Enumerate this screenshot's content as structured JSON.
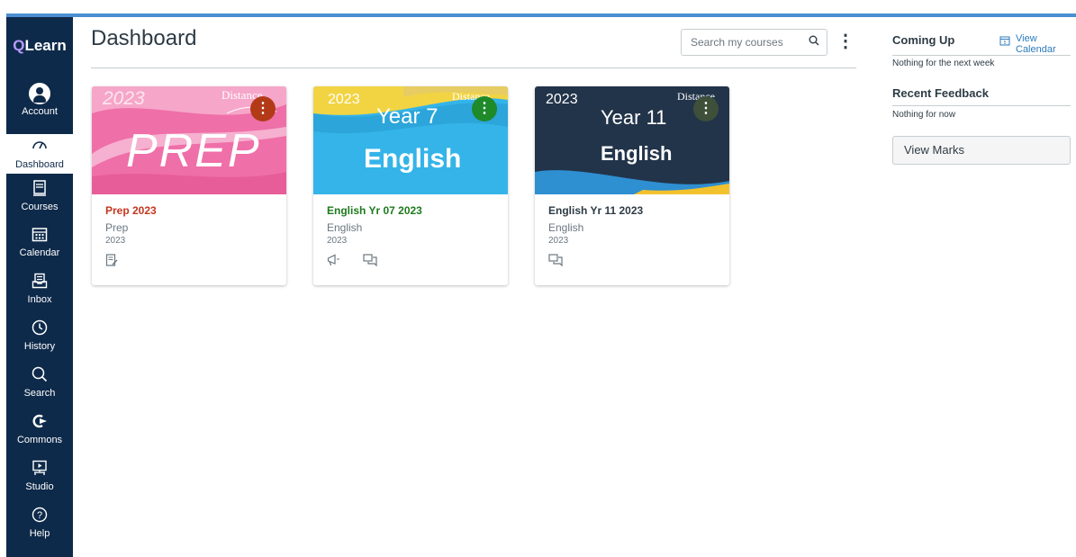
{
  "app": {
    "logo_q": "Q",
    "logo_rest": "Learn"
  },
  "nav": {
    "items": [
      {
        "label": "Account",
        "icon": "account-icon"
      },
      {
        "label": "Dashboard",
        "icon": "dashboard-icon"
      },
      {
        "label": "Courses",
        "icon": "courses-icon"
      },
      {
        "label": "Calendar",
        "icon": "calendar-icon"
      },
      {
        "label": "Inbox",
        "icon": "inbox-icon"
      },
      {
        "label": "History",
        "icon": "history-icon"
      },
      {
        "label": "Search",
        "icon": "search-icon"
      },
      {
        "label": "Commons",
        "icon": "commons-icon"
      },
      {
        "label": "Studio",
        "icon": "studio-icon"
      },
      {
        "label": "Help",
        "icon": "help-icon"
      }
    ],
    "active": "Dashboard"
  },
  "header": {
    "title": "Dashboard",
    "search_placeholder": "Search my courses"
  },
  "cards": [
    {
      "hero": {
        "year": "2023",
        "corner": "Distance",
        "big": "PREP"
      },
      "title": "Prep 2023",
      "subtitle": "Prep",
      "term": "2023",
      "title_color": "#c4361f",
      "menu_color": "#b23a16",
      "icons": [
        "assignments-icon"
      ]
    },
    {
      "hero": {
        "year": "2023",
        "corner": "Distance",
        "line1": "Year 7",
        "line2": "English"
      },
      "title": "English Yr 07 2023",
      "subtitle": "English",
      "term": "2023",
      "title_color": "#1f7a1f",
      "menu_color": "#1e8a2a",
      "icons": [
        "announcements-icon",
        "discussions-icon"
      ]
    },
    {
      "hero": {
        "year": "2023",
        "corner": "Distance",
        "line1": "Year 11",
        "line2": "English"
      },
      "title": "English Yr 11 2023",
      "subtitle": "English",
      "term": "2023",
      "title_color": "#2d3b45",
      "menu_color": "#3e4f3a",
      "icons": [
        "discussions-icon"
      ]
    }
  ],
  "sidebar_right": {
    "coming_up": {
      "title": "Coming Up",
      "link": "View Calendar",
      "text": "Nothing for the next week"
    },
    "feedback": {
      "title": "Recent Feedback",
      "text": "Nothing for now"
    },
    "button": "View Marks"
  },
  "colors": {
    "nav_bg": "#0e2a4a",
    "accent": "#4a8fd1",
    "link": "#2b7abc"
  }
}
